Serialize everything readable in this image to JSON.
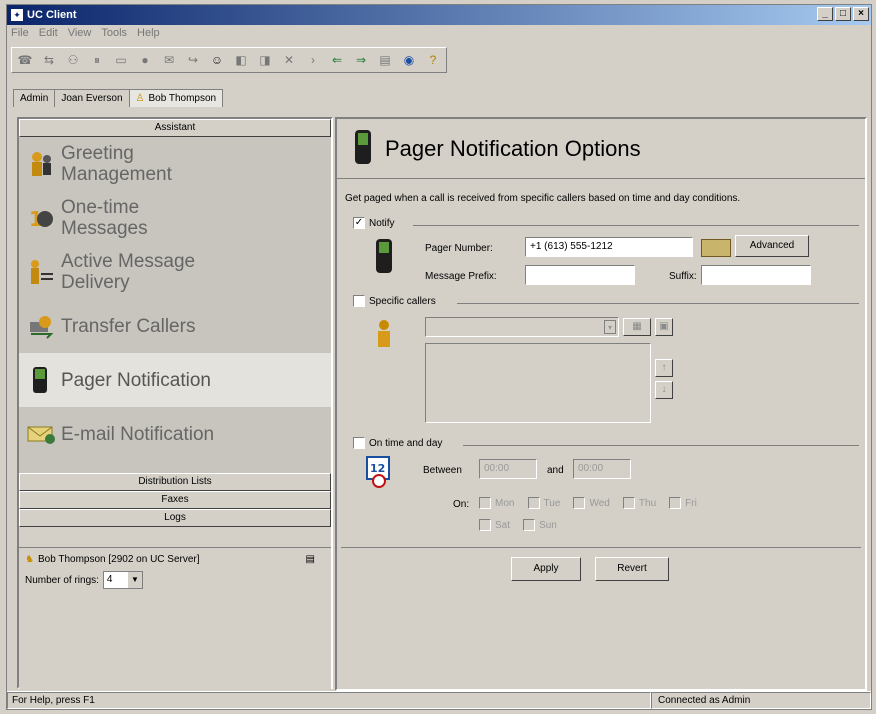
{
  "window": {
    "title": "UC Client"
  },
  "menu": [
    "File",
    "Edit",
    "View",
    "Tools",
    "Help"
  ],
  "toolbar_icons": [
    "call-icon",
    "transfer-icon",
    "conference-icon",
    "hold-icon",
    "park-icon",
    "record-icon",
    "mail-icon",
    "forward-icon",
    "contacts-icon",
    "mute-icon",
    "unmute-icon",
    "delete-icon",
    "play-icon",
    "back-icon",
    "next-icon",
    "save-icon",
    "globe-icon",
    "help-icon"
  ],
  "tabs": [
    {
      "label": "Admin"
    },
    {
      "label": "Joan Everson"
    },
    {
      "label": "Bob Thompson"
    }
  ],
  "left": {
    "assistant_header": "Assistant",
    "nav": [
      {
        "label": "Greeting\nManagement",
        "icon": "greeting-icon"
      },
      {
        "label": "One-time\nMessages",
        "icon": "one-time-icon"
      },
      {
        "label": "Active Message\nDelivery",
        "icon": "delivery-icon"
      },
      {
        "label": "Transfer Callers",
        "icon": "transfer-icon"
      },
      {
        "label": "Pager Notification",
        "icon": "pager-icon",
        "selected": true
      },
      {
        "label": "E-mail Notification",
        "icon": "email-icon"
      }
    ],
    "sections": [
      "Distribution Lists",
      "Faxes",
      "Logs"
    ],
    "caller": "Bob Thompson [2902 on UC Server]",
    "rings_label": "Number of rings:",
    "rings_value": "4"
  },
  "right": {
    "title": "Pager Notification Options",
    "description": "Get paged when a call is received from specific callers based on time and day conditions.",
    "notify_label": "Notify",
    "pager_number_label": "Pager Number:",
    "pager_number_value": "+1 (613) 555-1212",
    "advanced_label": "Advanced",
    "prefix_label": "Message Prefix:",
    "suffix_label": "Suffix:",
    "specific_callers_label": "Specific callers",
    "on_time_label": "On time and day",
    "between_label": "Between",
    "and_label": "and",
    "time_from": "00:00",
    "time_to": "00:00",
    "on_label": "On:",
    "days": [
      "Mon",
      "Tue",
      "Wed",
      "Thu",
      "Fri",
      "Sat",
      "Sun"
    ],
    "apply_label": "Apply",
    "revert_label": "Revert"
  },
  "status": {
    "left": "For Help, press F1",
    "right": "Connected as Admin"
  }
}
